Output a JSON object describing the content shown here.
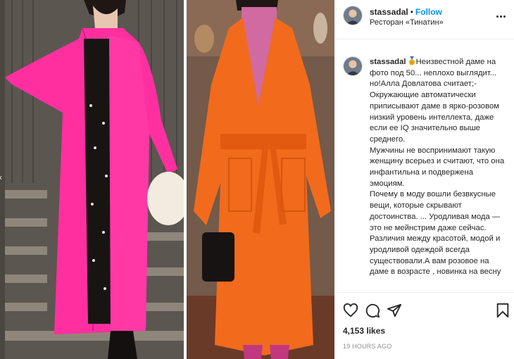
{
  "post": {
    "username": "stassadal",
    "separator": "•",
    "follow_label": "Follow",
    "location": "Ресторан «Тинатин»",
    "more_icon": "more-horizontal-icon"
  },
  "caption": {
    "username": "stassadal",
    "paragraphs": [
      "Неизвестной даме на фото под 50... неплохо выглядит... но!Алла Довлатова считает;- Окружающие автоматически приписывают даме в ярко-розовом низкий уровень интеллекта, даже если ее IQ значительно выше среднего.",
      "Мужчины не воспринимают такую женщину всерьез и считают, что она инфантильна и подвержена эмоциям.",
      "Почему в моду вошли безвкусные вещи, которые скрывают достоинства. ... Уродливая мода — это не мейнстрим даже сейчас. Различия между красотой, модой и уродливой одеждой всегда существовали.А вам розовое на даме в возрасте , новинка на весну"
    ]
  },
  "actions": {
    "icons": [
      "heart-icon",
      "comment-icon",
      "share-icon",
      "bookmark-icon"
    ],
    "likes": "4,153 likes",
    "timestamp": "19 HOURS AGO"
  },
  "colors": {
    "follow": "#0095f6",
    "pink_coat": "#ff2fa0",
    "orange_coat": "#f26a1c",
    "text": "#262626",
    "muted": "#8e8e8e"
  }
}
